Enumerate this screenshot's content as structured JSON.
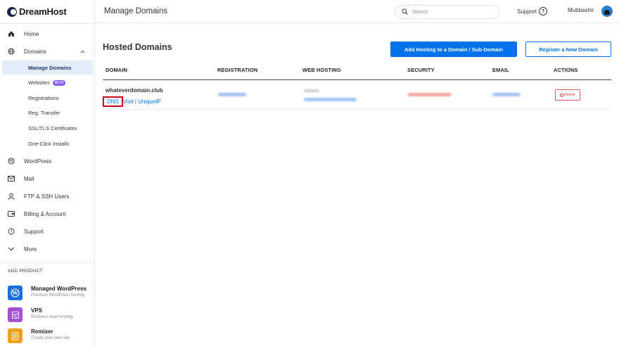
{
  "brand": {
    "name": "DreamHost"
  },
  "sidebar": {
    "nav": [
      {
        "label": "Home",
        "icon": "home-icon"
      },
      {
        "label": "Domains",
        "icon": "globe-icon"
      }
    ],
    "domains_sub": [
      {
        "label": "Manage Domains",
        "active": true
      },
      {
        "label": "Websites",
        "badge": "BETA"
      },
      {
        "label": "Registrations"
      },
      {
        "label": "Reg. Transfer"
      },
      {
        "label": "SSL/TLS Certificates"
      },
      {
        "label": "One-Click Installs"
      }
    ],
    "nav2": [
      {
        "label": "WordPress",
        "icon": "wordpress-icon"
      },
      {
        "label": "Mail",
        "icon": "mail-icon"
      },
      {
        "label": "FTP & SSH Users",
        "icon": "user-icon"
      },
      {
        "label": "Billing & Account",
        "icon": "wallet-icon"
      },
      {
        "label": "Support",
        "icon": "help-icon"
      },
      {
        "label": "More",
        "icon": "chevron-down-icon"
      }
    ],
    "add_product": "ADD PRODUCT",
    "products": [
      {
        "name": "Managed WordPress",
        "desc": "Premium WordPress hosting",
        "color": "#1a6fd8"
      },
      {
        "name": "VPS",
        "desc": "Business level hosting",
        "color": "#a24fd1"
      },
      {
        "name": "Remixer",
        "desc": "Create your own site",
        "color": "#f2a01e"
      }
    ]
  },
  "topbar": {
    "title": "Manage Domains",
    "search_placeholder": "Search",
    "support": "Support",
    "user": "Mubbashir"
  },
  "main": {
    "section_title": "Hosted Domains",
    "add_hosting_button": "Add Hosting to a Domain / Sub-Domain",
    "register_button": "Register a New Domain",
    "columns": [
      "DOMAIN",
      "REGISTRATION",
      "WEB HOSTING",
      "SECURITY",
      "EMAIL",
      "ACTIONS"
    ],
    "rows": [
      {
        "domain": "whateverdomain.club",
        "links": {
          "dns": "DNS",
          "visit": "Visit",
          "sep": "|",
          "unique_ip": "UniqueIP"
        },
        "delete": "Delete"
      }
    ]
  },
  "colors": {
    "primary": "#0073ec",
    "danger": "#d0021b",
    "active_bg": "#e3ecf7"
  }
}
